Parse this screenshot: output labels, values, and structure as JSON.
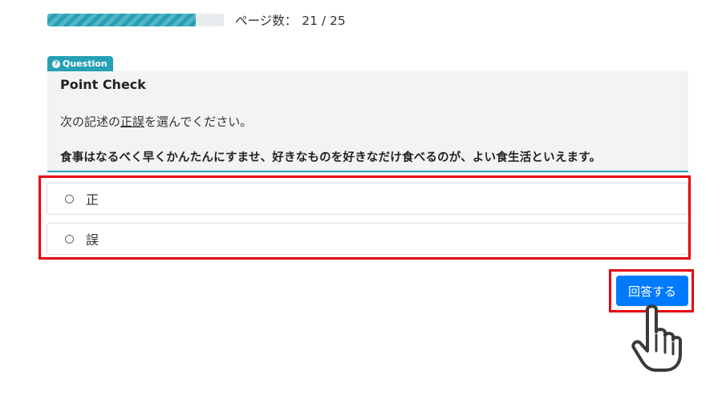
{
  "progress": {
    "value": 0.84,
    "label": "ページ数：",
    "count": "21 / 25"
  },
  "question": {
    "tag": "Question",
    "tag_icon": "question-circle-icon",
    "title": "Point Check",
    "instruction_before": "次の記述の",
    "instruction_underlined": "正誤",
    "instruction_after": "を選んでください。",
    "statement": "食事はなるべく早くかんたんにすませ、好きなものを好きなだけ食べるのが、よい食生活といえます。"
  },
  "options": [
    {
      "label": "正"
    },
    {
      "label": "誤"
    }
  ],
  "submit_label": "回答する",
  "colors": {
    "accent": "#26a0b4",
    "highlight": "#e60012",
    "button": "#007bff"
  },
  "cursor_icon": "hand-pointer-icon"
}
